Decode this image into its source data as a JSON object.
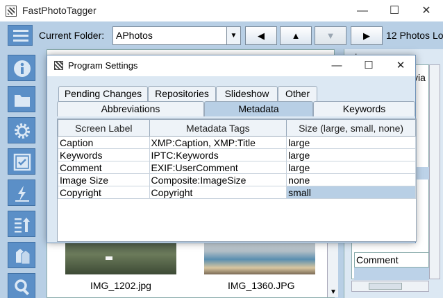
{
  "window": {
    "title": "FastPhotoTagger",
    "minimize": "—",
    "maximize": "☐",
    "close": "✕"
  },
  "toolbar": {
    "folder_label": "Current Folder:",
    "folder_value": "APhotos",
    "folder_arrow": "▼",
    "prev": "◀",
    "up": "▲",
    "down": "▼",
    "next": "▶",
    "photo_count": "12 Photos Lo"
  },
  "sidebar": {
    "icons": [
      "info-icon",
      "folder-icon",
      "gear-icon",
      "checkbox-icon",
      "lightning-icon",
      "sort-icon",
      "tags-icon",
      "search-icon"
    ]
  },
  "grid": {
    "files": [
      "IMG_1202.jpg",
      "IMG_1360.JPG"
    ]
  },
  "right_panel": {
    "tab_label": "el...",
    "fragment": "via",
    "item": "Comment"
  },
  "dialog": {
    "title": "Program Settings",
    "minimize": "—",
    "maximize": "☐",
    "close": "✕",
    "tabs_row1": [
      "Pending Changes",
      "Repositories",
      "Slideshow",
      "Other"
    ],
    "tabs_row2": [
      "Abbreviations",
      "Metadata",
      "Keywords"
    ],
    "active_tab": "Metadata",
    "table": {
      "headers": [
        "Screen Label",
        "Metadata Tags",
        "Size (large, small, none)"
      ],
      "rows": [
        [
          "Caption",
          "XMP:Caption, XMP:Title",
          "large"
        ],
        [
          "Keywords",
          "IPTC:Keywords",
          "large"
        ],
        [
          "Comment",
          "EXIF:UserComment",
          "large"
        ],
        [
          "Image Size",
          "Composite:ImageSize",
          "none"
        ],
        [
          "Copyright",
          "Copyright",
          "small"
        ]
      ]
    }
  },
  "colors": {
    "accent": "#5b8fc7",
    "panel": "#b8cfe5",
    "selection": "#b8cfe5"
  }
}
